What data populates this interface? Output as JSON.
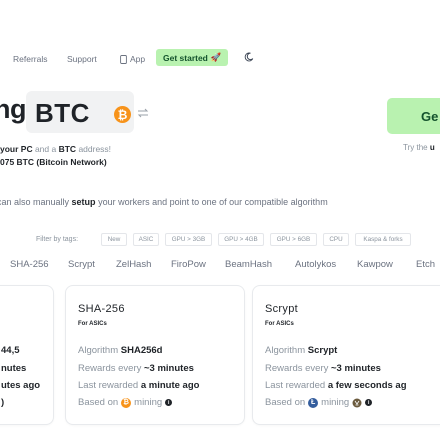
{
  "nav": {
    "referrals": "Referrals",
    "support": "Support",
    "app": "App",
    "get_started": "Get started",
    "get_started_emoji": "🚀"
  },
  "hero": {
    "word_fragment": "ng",
    "coin": "BTC",
    "coin_symbol": "₿",
    "cta_fragment": "Ge",
    "sub_parts": [
      "your PC",
      " and a ",
      "BTC",
      " address!"
    ],
    "sub2": "075 BTC (Bitcoin Network)",
    "try_hint_prefix": "Try the ",
    "try_hint_bold": "u"
  },
  "manual": {
    "prefix": "can also manually ",
    "bold": "setup",
    "suffix": " your workers and point to one of our compatible algorithm"
  },
  "filters": {
    "label": "Filter by tags:",
    "tags": [
      "New",
      "ASIC",
      "GPU > 3GB",
      "GPU > 4GB",
      "GPU > 6GB",
      "CPU",
      "Kaspa & forks"
    ]
  },
  "algo_tabs": [
    "SHA-256",
    "Scrypt",
    "ZelHash",
    "FiroPow",
    "BeamHash",
    "Autolykos",
    "Kawpow",
    "Etch"
  ],
  "cards": {
    "left": {
      "lines": [
        "44,5",
        "nutes",
        "utes ago",
        ")"
      ]
    },
    "middle": {
      "title": "SHA-256",
      "for": "For ASICs",
      "algo_label": "Algorithm ",
      "algo_value": "SHA256d",
      "rewards_label": "Rewards every ",
      "rewards_value": "~3 minutes",
      "last_label": "Last rewarded ",
      "last_value": "a minute ago",
      "based_label": "Based on",
      "mining_label": "mining"
    },
    "right": {
      "title": "Scrypt",
      "for": "For ASICs",
      "algo_label": "Algorithm ",
      "algo_value": "Scrypt",
      "rewards_label": "Rewards every ",
      "rewards_value": "~3 minutes",
      "last_label": "Last rewarded ",
      "last_value": "a few seconds ag",
      "based_label": "Based on",
      "mining_label": "mining"
    }
  },
  "colors": {
    "accent_green": "#b9f2b0",
    "bitcoin_orange": "#f7931a",
    "litecoin_blue": "#345d9d"
  }
}
